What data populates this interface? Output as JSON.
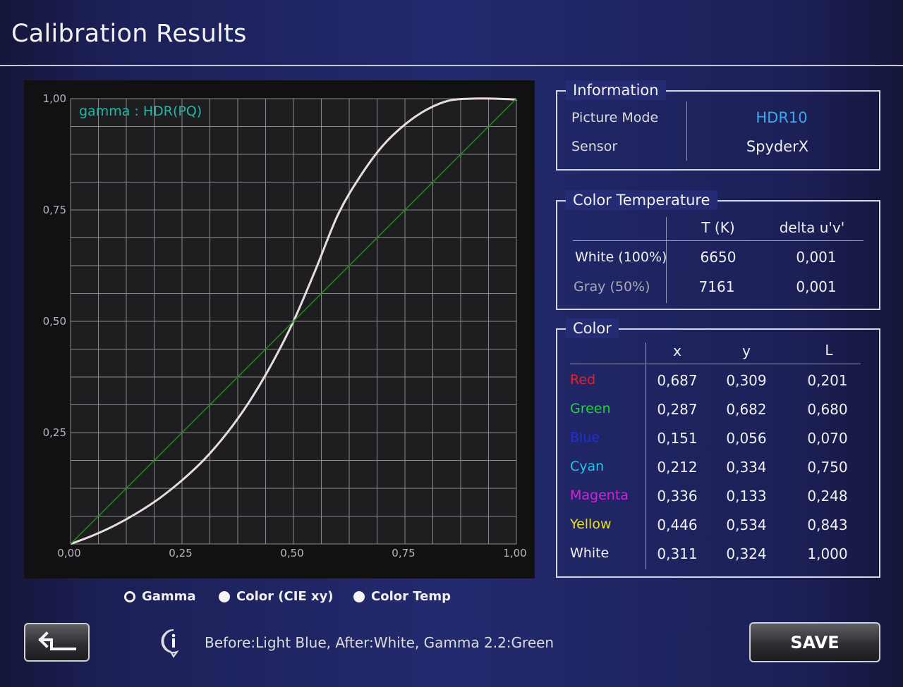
{
  "header": {
    "title": "Calibration Results"
  },
  "chart_data": {
    "type": "line",
    "annotation": "gamma :  HDR(PQ)",
    "x_ticks": [
      "0,00",
      "0,25",
      "0,50",
      "0,75",
      "1,00"
    ],
    "y_ticks": [
      "1,00",
      "0,75",
      "0,50",
      "0,25"
    ],
    "xlim": [
      0,
      1
    ],
    "ylim": [
      0,
      1
    ],
    "grid": true,
    "series": [
      {
        "color": "#e8dce2",
        "x": [
          0,
          0.05,
          0.1,
          0.15,
          0.2,
          0.25,
          0.3,
          0.35,
          0.4,
          0.45,
          0.5,
          0.55,
          0.6,
          0.65,
          0.7,
          0.75,
          0.8,
          0.85,
          0.9,
          0.95,
          1.0
        ],
        "y": [
          0,
          0.019,
          0.042,
          0.07,
          0.103,
          0.143,
          0.19,
          0.248,
          0.318,
          0.402,
          0.5,
          0.617,
          0.74,
          0.826,
          0.894,
          0.942,
          0.976,
          0.996,
          1.0,
          1.0,
          0.998
        ]
      },
      {
        "color": "#1f8a1f",
        "x": [
          0,
          1
        ],
        "y": [
          0,
          1
        ]
      }
    ]
  },
  "radio_options": [
    "Gamma",
    "Color (CIE xy)",
    "Color Temp"
  ],
  "information": {
    "title": "Information",
    "picture_mode_label": "Picture Mode",
    "picture_mode_value": "HDR10",
    "picture_mode_color": "#38a8f0",
    "sensor_label": "Sensor",
    "sensor_value": "SpyderX"
  },
  "color_temperature": {
    "title": "Color Temperature",
    "headers": [
      "T (K)",
      "delta u'v'"
    ],
    "rows": [
      {
        "label": "White (100%)",
        "t": "6650",
        "delta": "0,001"
      },
      {
        "label": "Gray (50%)",
        "t": "7161",
        "delta": "0,001"
      }
    ]
  },
  "color": {
    "title": "Color",
    "headers": [
      "x",
      "y",
      "L"
    ],
    "rows": [
      {
        "name": "Red",
        "color": "#e8202a",
        "x": "0,687",
        "y": "0,309",
        "L": "0,201"
      },
      {
        "name": "Green",
        "color": "#22d040",
        "x": "0,287",
        "y": "0,682",
        "L": "0,680"
      },
      {
        "name": "Blue",
        "color": "#2030d8",
        "x": "0,151",
        "y": "0,056",
        "L": "0,070"
      },
      {
        "name": "Cyan",
        "color": "#20c8e8",
        "x": "0,212",
        "y": "0,334",
        "L": "0,750"
      },
      {
        "name": "Magenta",
        "color": "#d820d8",
        "x": "0,336",
        "y": "0,133",
        "L": "0,248"
      },
      {
        "name": "Yellow",
        "color": "#e8e020",
        "x": "0,446",
        "y": "0,534",
        "L": "0,843"
      },
      {
        "name": "White",
        "color": "#f0f0f0",
        "x": "0,311",
        "y": "0,324",
        "L": "1,000"
      }
    ]
  },
  "footer": {
    "back_icon": "back-arrow-icon",
    "info_icon": "info-icon",
    "legend_text": "Before:Light Blue,   After:White,   Gamma 2.2:Green",
    "save_label": "SAVE"
  }
}
